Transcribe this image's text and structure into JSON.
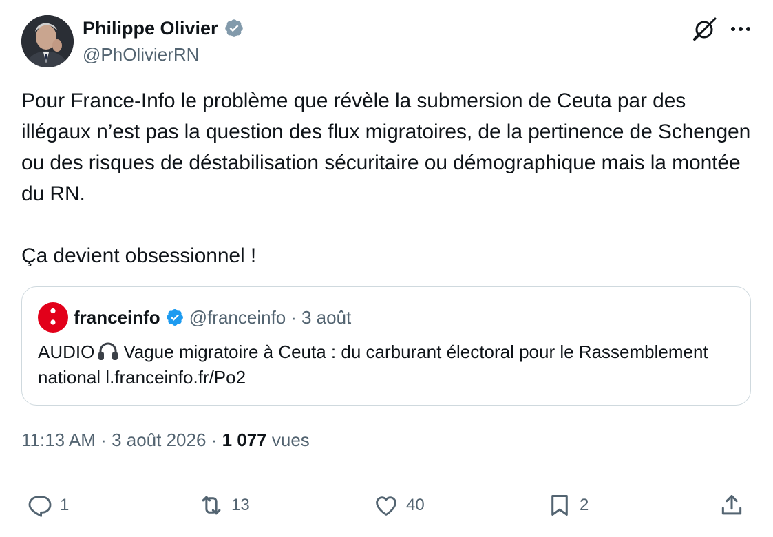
{
  "author": {
    "name": "Philippe Olivier",
    "handle": "@PhOlivierRN"
  },
  "tweet": {
    "text": "Pour France-Info le problème que révèle la submersion de Ceuta par des illégaux n’est pas la question des flux migratoires, de la pertinence de Schengen ou des risques de déstabilisation sécuritaire ou démographique mais la montée du RN.\n\nÇa devient obsessionnel !"
  },
  "quote": {
    "name": "franceinfo",
    "handle": "@franceinfo",
    "separator": "·",
    "date": "3 août",
    "text_prefix": "AUDIO",
    "text_body": "Vague migratoire à Ceuta : du carburant électoral pour le Rassemblement national l.franceinfo.fr/Po2"
  },
  "meta": {
    "time": "11:13 AM",
    "sep1": "·",
    "date": "3 août 2026",
    "sep2": "·",
    "views_count": "1 077",
    "views_label": "vues"
  },
  "actions": {
    "replies": "1",
    "reposts": "13",
    "likes": "40",
    "bookmarks": "2"
  },
  "icons": {
    "verified": "verified-badge-icon",
    "grok": "grok-icon",
    "more": "more-icon",
    "headphones": "headphones-icon",
    "reply": "reply-icon",
    "repost": "repost-icon",
    "like": "heart-icon",
    "bookmark": "bookmark-icon",
    "share": "share-icon"
  },
  "colors": {
    "verified_blue": "#1d9bf0",
    "verified_gray": "#829aab",
    "franceinfo_red": "#e2001a",
    "text_secondary": "#536471"
  }
}
